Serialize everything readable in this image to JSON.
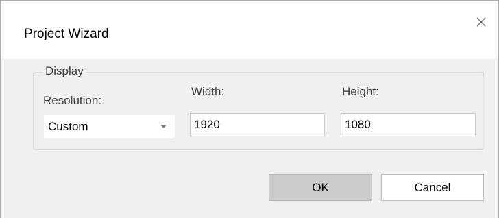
{
  "window": {
    "title": "Project Wizard",
    "close_glyph": "close-icon"
  },
  "display_group": {
    "legend": "Display",
    "resolution": {
      "label": "Resolution:",
      "selected": "Custom"
    },
    "width": {
      "label": "Width:",
      "value": "1920"
    },
    "height": {
      "label": "Height:",
      "value": "1080"
    }
  },
  "buttons": {
    "ok_label": "OK",
    "cancel_label": "Cancel"
  },
  "colors": {
    "dialog_background": "#f0f0f0",
    "title_background": "#ffffff",
    "ok_button_background": "#cccccc"
  }
}
